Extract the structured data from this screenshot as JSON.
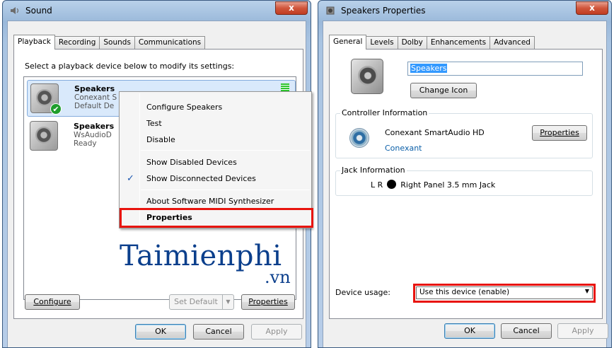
{
  "sound_window": {
    "title": "Sound",
    "close_label": "x",
    "tabs": [
      "Playback",
      "Recording",
      "Sounds",
      "Communications"
    ],
    "instruction": "Select a playback device below to modify its settings:",
    "devices": [
      {
        "name": "Speakers",
        "line1": "Conexant S",
        "line2": "Default De",
        "default": true
      },
      {
        "name": "Speakers",
        "line1": "WsAudioD",
        "line2": "Ready",
        "default": false
      }
    ],
    "context_menu": {
      "items": [
        "Configure Speakers",
        "Test",
        "Disable",
        "Show Disabled Devices",
        "Show Disconnected Devices",
        "About Software MIDI Synthesizer",
        "Properties"
      ],
      "checked_item": "Show Disconnected Devices"
    },
    "watermark": {
      "main": "Taimienphi",
      "suffix": ".vn"
    },
    "buttons": {
      "configure": "Configure",
      "set_default": "Set Default",
      "properties": "Properties",
      "ok": "OK",
      "cancel": "Cancel",
      "apply": "Apply"
    }
  },
  "properties_window": {
    "title": "Speakers Properties",
    "close_label": "x",
    "tabs": [
      "General",
      "Levels",
      "Dolby",
      "Enhancements",
      "Advanced"
    ],
    "device_name": "Speakers",
    "change_icon_label": "Change Icon",
    "controller": {
      "group_label": "Controller Information",
      "name": "Conexant SmartAudio HD",
      "vendor": "Conexant",
      "properties_label": "Properties"
    },
    "jack": {
      "group_label": "Jack Information",
      "channels": "L R",
      "description": "Right Panel 3.5 mm Jack"
    },
    "device_usage": {
      "label": "Device usage:",
      "value": "Use this device (enable)"
    },
    "buttons": {
      "ok": "OK",
      "cancel": "Cancel",
      "apply": "Apply"
    }
  },
  "colors": {
    "highlight_box": "#e8140e",
    "selection": "#d9e9fb",
    "watermark": "#0b3f8c"
  }
}
